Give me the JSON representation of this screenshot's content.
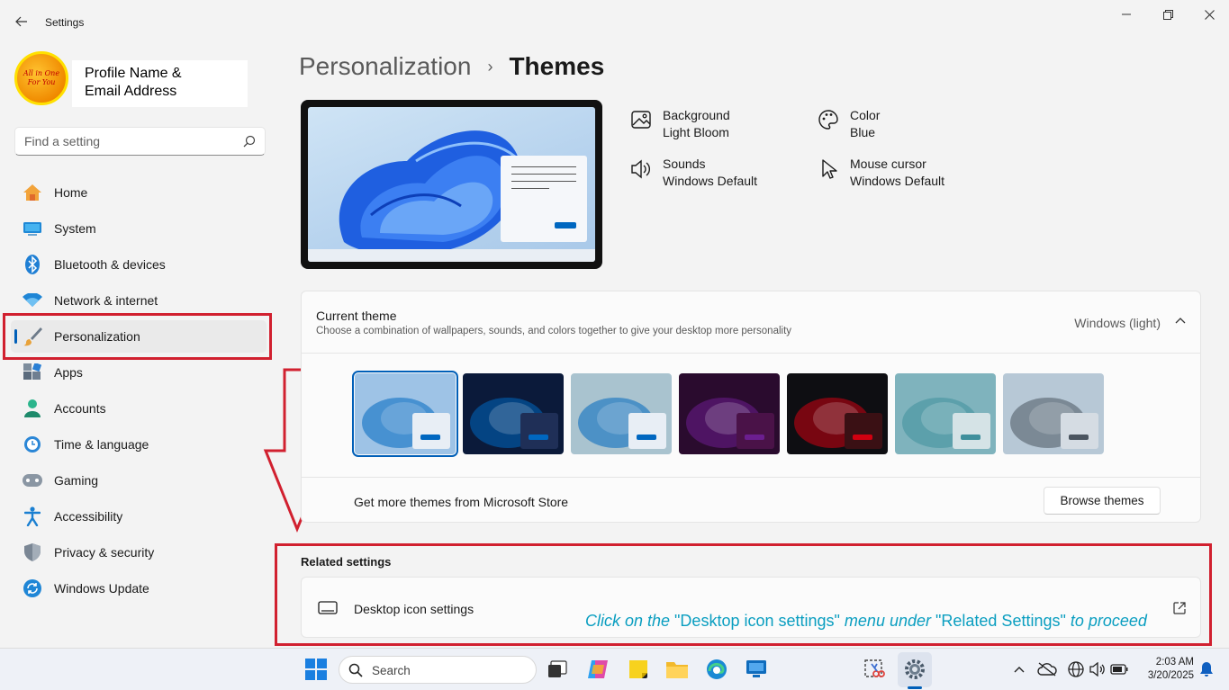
{
  "window": {
    "title": "Settings"
  },
  "profile": {
    "avatar_line1": "All in One",
    "avatar_line2": "For You",
    "name": "Profile Name &",
    "email": "Email Address"
  },
  "search": {
    "placeholder": "Find a setting"
  },
  "sidebar": {
    "items": [
      {
        "label": "Home",
        "icon": "home-icon"
      },
      {
        "label": "System",
        "icon": "system-icon"
      },
      {
        "label": "Bluetooth & devices",
        "icon": "bluetooth-icon"
      },
      {
        "label": "Network & internet",
        "icon": "wifi-icon"
      },
      {
        "label": "Personalization",
        "icon": "brush-icon",
        "active": true
      },
      {
        "label": "Apps",
        "icon": "apps-icon"
      },
      {
        "label": "Accounts",
        "icon": "accounts-icon"
      },
      {
        "label": "Time & language",
        "icon": "clock-globe-icon"
      },
      {
        "label": "Gaming",
        "icon": "gamepad-icon"
      },
      {
        "label": "Accessibility",
        "icon": "accessibility-icon"
      },
      {
        "label": "Privacy & security",
        "icon": "shield-icon"
      },
      {
        "label": "Windows Update",
        "icon": "update-icon"
      }
    ]
  },
  "header": {
    "parent": "Personalization",
    "separator": "›",
    "current": "Themes"
  },
  "theme_info": {
    "background": {
      "label": "Background",
      "value": "Light Bloom"
    },
    "color": {
      "label": "Color",
      "value": "Blue"
    },
    "sounds": {
      "label": "Sounds",
      "value": "Windows Default"
    },
    "cursor": {
      "label": "Mouse cursor",
      "value": "Windows Default"
    }
  },
  "current_theme": {
    "title": "Current theme",
    "subtitle": "Choose a combination of wallpapers, sounds, and colors together to give your desktop more personality",
    "value": "Windows (light)",
    "store_text": "Get more themes from Microsoft Store",
    "browse_label": "Browse themes"
  },
  "themes": [
    {
      "name": "windows-light",
      "bg": "#9ec3e6",
      "accent": "#0067c0",
      "win": "#e8eef5"
    },
    {
      "name": "windows-dark",
      "bg": "#0b1a3a",
      "accent": "#0067c0",
      "win": "#1f2f57"
    },
    {
      "name": "spotlight",
      "bg": "#a9c3cf",
      "accent": "#0067c0",
      "win": "#e8eef5"
    },
    {
      "name": "glow",
      "bg": "#2a0b2e",
      "accent": "#6b1e8f",
      "win": "#4a1248"
    },
    {
      "name": "captured-motion",
      "bg": "#0e0e12",
      "accent": "#d00010",
      "win": "#3a1014"
    },
    {
      "name": "sunrise",
      "bg": "#7fb3bd",
      "accent": "#3f8f9c",
      "win": "#d5e3e6"
    },
    {
      "name": "flow",
      "bg": "#b7c8d6",
      "accent": "#4b5560",
      "win": "#d5dce3"
    }
  ],
  "related": {
    "title": "Related settings",
    "desktop_icon_settings": "Desktop icon settings"
  },
  "instruction": {
    "part1": "Click on the ",
    "part2": "\"Desktop icon settings\"",
    "part3": " menu under ",
    "part4": "\"Related Settings\"",
    "part5": " to proceed"
  },
  "taskbar": {
    "search_label": "Search",
    "time": "2:03 AM",
    "date": "3/20/2025"
  },
  "colors": {
    "accent": "#005fb8",
    "annotation_red": "#d1202f",
    "instruction_text": "#0a9ec0"
  }
}
